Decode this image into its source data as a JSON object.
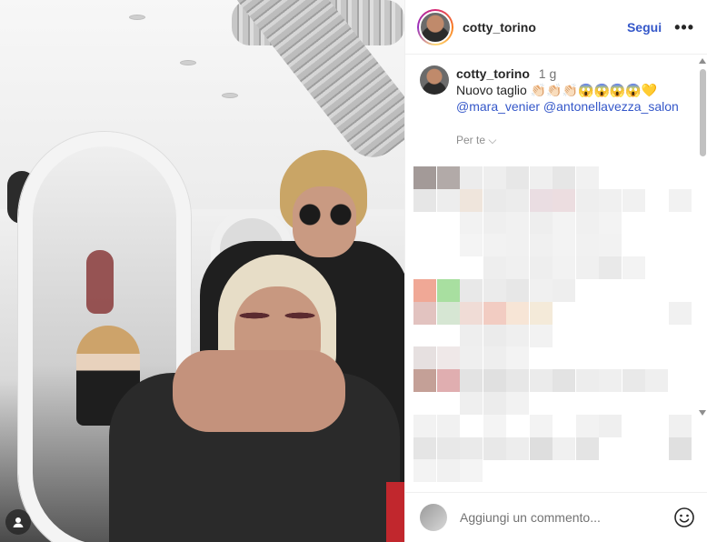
{
  "post": {
    "username": "cotty_torino",
    "follow_label": "Segui",
    "more_label": "•••"
  },
  "caption": {
    "username": "cotty_torino",
    "time": "1 g",
    "text": "Nuovo taglio 👏🏻👏🏻👏🏻😱😱😱😱💛",
    "mention_1": "@mara_venier",
    "mention_2": "@antonellavezza_salon",
    "see_translation": "Per te ⌵"
  },
  "footer": {
    "comment_placeholder": "Aggiungi un commento..."
  },
  "icons": {
    "more": "more-options-icon",
    "emoji": "emoji-icon",
    "camera": "camera-icon"
  },
  "colors": {
    "link": "#3457c9",
    "text": "#262626",
    "muted": "#737373"
  }
}
